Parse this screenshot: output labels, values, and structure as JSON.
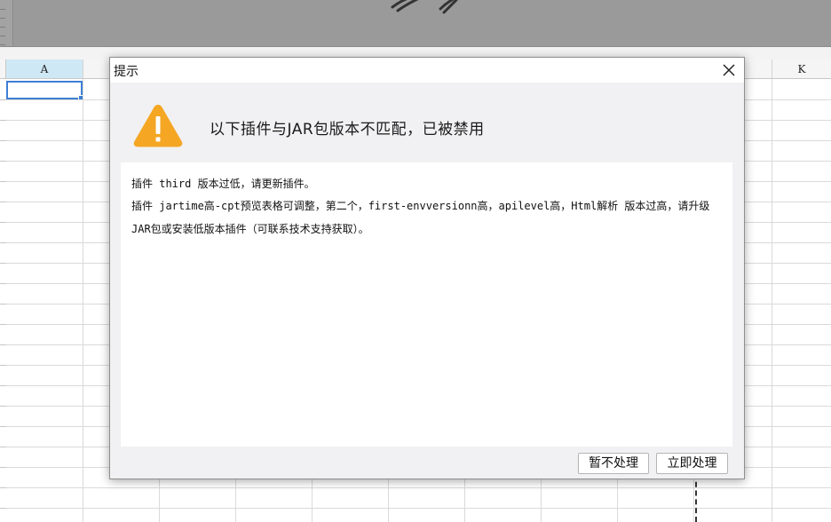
{
  "spreadsheet": {
    "columns": [
      "A",
      "K"
    ],
    "selected_cell": "A1"
  },
  "dialog": {
    "title": "提示",
    "headline": "以下插件与JAR包版本不匹配，已被禁用",
    "messages": [
      "插件 third 版本过低，请更新插件。",
      "插件 jartime高-cpt预览表格可调整，第二个，first-envversionn高，apilevel高，Html解析 版本过高，请升级JAR包或安装低版本插件（可联系技术支持获取）。"
    ],
    "buttons": {
      "later": "暂不处理",
      "now": "立即处理"
    },
    "icons": {
      "close": "close-icon",
      "warning": "warning-icon"
    },
    "colors": {
      "warning": "#f5a623",
      "selection": "#3d7fd4"
    }
  }
}
